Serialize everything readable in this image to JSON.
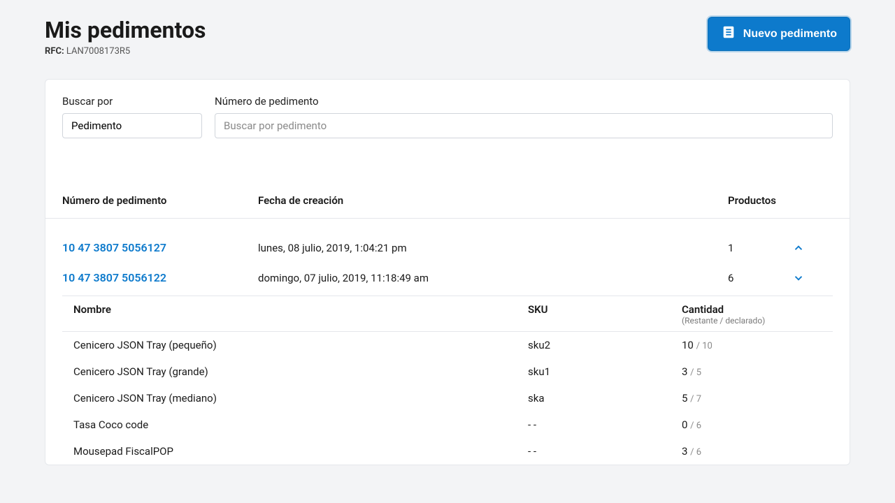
{
  "header": {
    "title": "Mis pedimentos",
    "rfc_label": "RFC:",
    "rfc_value": "LAN7008173R5",
    "new_button": "Nuevo pedimento"
  },
  "search": {
    "by_label": "Buscar por",
    "by_value": "Pedimento",
    "num_label": "Número de pedimento",
    "num_placeholder": "Buscar por pedimento"
  },
  "table": {
    "headers": {
      "number": "Número de pedimento",
      "created": "Fecha de creación",
      "products": "Productos"
    },
    "rows": [
      {
        "number": "10 47 3807 5056127",
        "created": "lunes, 08 julio, 2019, 1:04:21 pm",
        "products": "1",
        "expanded": false
      },
      {
        "number": "10 47 3807 5056122",
        "created": "domingo, 07 julio, 2019, 11:18:49 am",
        "products": "6",
        "expanded": true
      }
    ]
  },
  "subtable": {
    "headers": {
      "name": "Nombre",
      "sku": "SKU",
      "qty": "Cantidad",
      "qty_sub": "(Restante / declarado)"
    },
    "rows": [
      {
        "name": "Cenicero JSON Tray (pequeño)",
        "sku": "sku2",
        "remaining": "10",
        "declared": "10"
      },
      {
        "name": "Cenicero JSON Tray (grande)",
        "sku": "sku1",
        "remaining": "3",
        "declared": "5"
      },
      {
        "name": "Cenicero JSON Tray (mediano)",
        "sku": "ska",
        "remaining": "5",
        "declared": "7"
      },
      {
        "name": "Tasa Coco code",
        "sku": "- -",
        "remaining": "0",
        "declared": "6"
      },
      {
        "name": "Mousepad FiscalPOP",
        "sku": "- -",
        "remaining": "3",
        "declared": "6"
      }
    ]
  }
}
